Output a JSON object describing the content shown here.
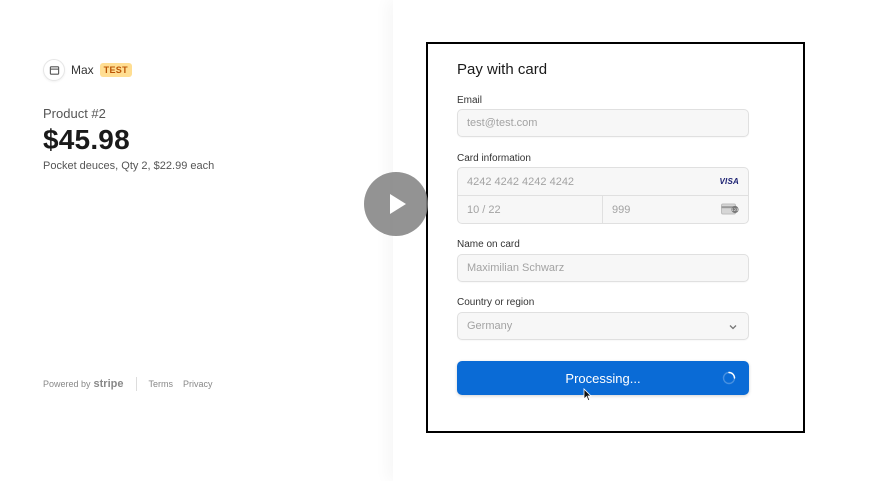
{
  "merchant": {
    "name": "Max",
    "badge": "TEST"
  },
  "product": {
    "name": "Product #2",
    "price": "$45.98",
    "description": "Pocket deuces, Qty 2, $22.99 each"
  },
  "footer": {
    "powered_by": "Powered by",
    "brand": "stripe",
    "terms": "Terms",
    "privacy": "Privacy"
  },
  "form": {
    "title": "Pay with card",
    "email": {
      "label": "Email",
      "value": "test@test.com"
    },
    "card": {
      "label": "Card information",
      "number": "4242 4242 4242 4242",
      "expiry": "10 / 22",
      "cvc": "999",
      "brand_icon": "VISA"
    },
    "name_on_card": {
      "label": "Name on card",
      "value": "Maximilian Schwarz"
    },
    "country": {
      "label": "Country or region",
      "value": "Germany"
    },
    "submit": {
      "label": "Processing..."
    }
  },
  "colors": {
    "accent": "#0a6bd6",
    "test_badge_bg": "#ffde92",
    "test_badge_text": "#bb5504"
  },
  "icons": [
    "store-icon",
    "play-icon",
    "visa-icon",
    "cvc-card-icon",
    "chevron-down-icon",
    "spinner-icon",
    "mouse-cursor-icon"
  ]
}
